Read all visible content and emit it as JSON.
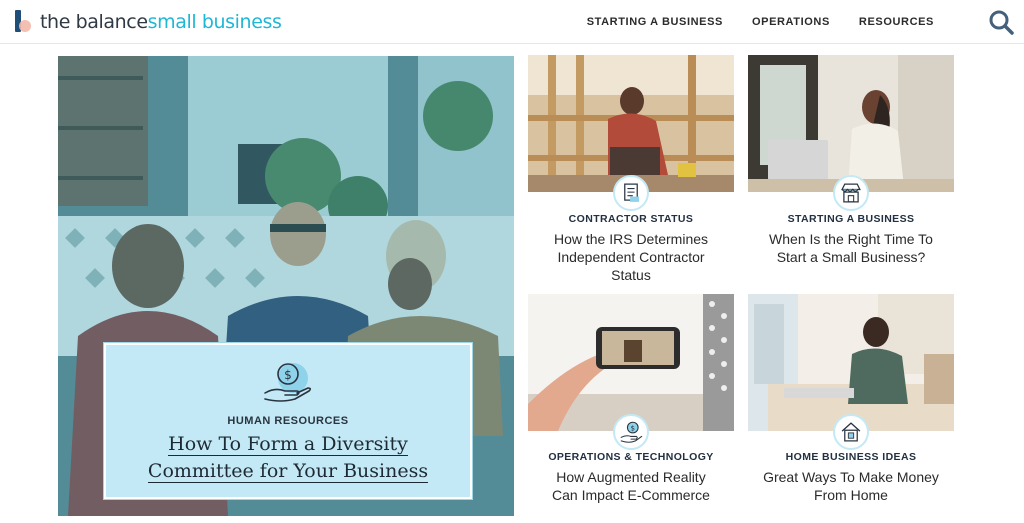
{
  "header": {
    "logo_part1": "the balance",
    "logo_part2": "small business",
    "nav": [
      "STARTING A BUSINESS",
      "OPERATIONS",
      "RESOURCES"
    ],
    "search_icon": "search-icon",
    "colors": {
      "brand_dark": "#2f3a45",
      "brand_accent": "#1fb7d6"
    }
  },
  "hero": {
    "category": "HUMAN RESOURCES",
    "title_line1": "How To Form a Diversity",
    "title_line2": "Committee for Your Business",
    "icon": "hand-dollar-icon",
    "card_color": "#c3e9f6"
  },
  "cards": [
    {
      "category": "CONTRACTOR STATUS",
      "title": [
        "How the IRS Determines",
        "Independent Contractor",
        "Status"
      ],
      "icon": "document-icon"
    },
    {
      "category": "STARTING A BUSINESS",
      "title": [
        "When Is the Right Time To",
        "Start a Small Business?"
      ],
      "icon": "storefront-icon"
    },
    {
      "category": "OPERATIONS & TECHNOLOGY",
      "title": [
        "How Augmented Reality",
        "Can Impact E-Commerce"
      ],
      "icon": "hand-dollar-icon"
    },
    {
      "category": "HOME BUSINESS IDEAS",
      "title": [
        "Great Ways To Make Money",
        "From Home"
      ],
      "icon": "house-icon"
    }
  ]
}
